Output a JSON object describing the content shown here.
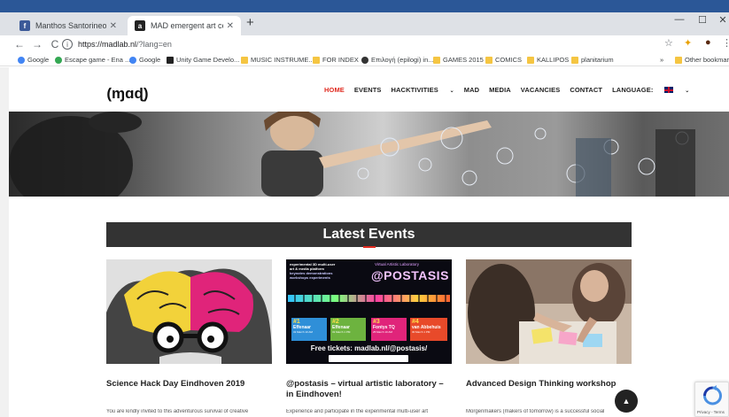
{
  "browser": {
    "tabs": [
      {
        "title": "Manthos Santorineos",
        "favicon": "facebook-icon",
        "favicon_color": "#3b5998"
      },
      {
        "title": "MAD emergent art center",
        "favicon": "mad-icon",
        "favicon_color": "#222222"
      }
    ],
    "url_host": "https://madlab.nl",
    "url_path": "/?lang=en",
    "bookmarks": [
      {
        "label": "Google",
        "icon": "google-icon"
      },
      {
        "label": "Escape game - Ena ...",
        "icon": "globe-icon"
      },
      {
        "label": "Google",
        "icon": "google-icon"
      },
      {
        "label": "Unity Game Develo...",
        "icon": "unity-icon"
      },
      {
        "label": "MUSIC INSTRUME...",
        "icon": "folder-icon"
      },
      {
        "label": "FOR INDEX",
        "icon": "folder-icon"
      },
      {
        "label": "Επιλογή (epilogi) in...",
        "icon": "link-icon"
      },
      {
        "label": "GAMES 2015",
        "icon": "folder-icon"
      },
      {
        "label": "COMICS",
        "icon": "folder-icon"
      },
      {
        "label": "KALLIPOS",
        "icon": "folder-icon"
      },
      {
        "label": "planitarium",
        "icon": "folder-icon"
      }
    ],
    "other_bookmarks": "Other bookmarks",
    "more_bookmarks": "»"
  },
  "site": {
    "nav": [
      "HOME",
      "EVENTS",
      "HACKTIVITIES",
      "MAD",
      "MEDIA",
      "VACANCIES",
      "CONTACT",
      "LANGUAGE:"
    ],
    "section_title": "Latest Events",
    "events": [
      {
        "title": "Science Hack Day Eindhoven 2019",
        "excerpt": "You are kindly invited to this adventurous survival of creative"
      },
      {
        "title": "@postasis – virtual artistic laboratory – in Eindhoven!",
        "excerpt": "Experience and participate in the experimental multi-user art"
      },
      {
        "title": "Advanced Design Thinking workshop",
        "excerpt": "Morgenmakers (makers of tomorrow) is a successful social"
      }
    ],
    "postasis_poster": {
      "header_lines": [
        "experimental 3D multi-user",
        "art & media platform",
        "keynotes demonstrations",
        "workshops experiments"
      ],
      "lab_label": "Virtual Artistic Laboratory",
      "brand": "@POSTASIS",
      "slots": [
        {
          "num": "#1",
          "name": "Effenaar",
          "date": "31 March 10 AM",
          "color": "#2f8fd8"
        },
        {
          "num": "#2",
          "name": "Effenaar",
          "date": "31 March 1 PM",
          "color": "#6db33f"
        },
        {
          "num": "#3",
          "name": "Fontys TQ",
          "date": "25 March 10 AM",
          "color": "#e0247a"
        },
        {
          "num": "#4",
          "name": "van Abbehuis",
          "date": "30 March 1 PM",
          "color": "#e84a2a"
        }
      ],
      "tickets": "Free tickets: madlab.nl/@postasis/"
    },
    "recaptcha_text": "Privacy - Terms"
  }
}
